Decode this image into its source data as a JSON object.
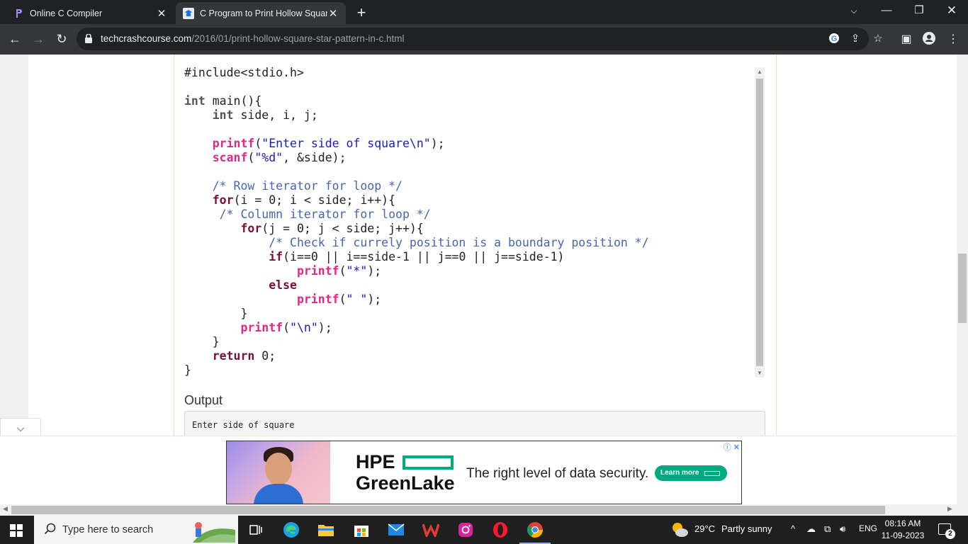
{
  "browser": {
    "tabs": [
      {
        "title": "Online C Compiler",
        "active": false
      },
      {
        "title": "C Program to Print Hollow Squar",
        "active": true
      }
    ],
    "url_host": "techcrashcourse.com",
    "url_path": "/2016/01/print-hollow-square-star-pattern-in-c.html"
  },
  "code_lines": [
    {
      "parts": [
        {
          "t": "#include<stdio.h>",
          "c": "pp"
        }
      ]
    },
    {
      "parts": []
    },
    {
      "parts": [
        {
          "t": "int",
          "c": "ty"
        },
        {
          "t": " main(){",
          "c": ""
        }
      ]
    },
    {
      "parts": [
        {
          "t": "    ",
          "c": ""
        },
        {
          "t": "int",
          "c": "ty"
        },
        {
          "t": " side, i, j;",
          "c": ""
        }
      ]
    },
    {
      "parts": []
    },
    {
      "parts": [
        {
          "t": "    ",
          "c": ""
        },
        {
          "t": "printf",
          "c": "fn"
        },
        {
          "t": "(",
          "c": ""
        },
        {
          "t": "\"Enter side of square\\n\"",
          "c": "str"
        },
        {
          "t": ");",
          "c": ""
        }
      ]
    },
    {
      "parts": [
        {
          "t": "    ",
          "c": ""
        },
        {
          "t": "scanf",
          "c": "fn"
        },
        {
          "t": "(",
          "c": ""
        },
        {
          "t": "\"%d\"",
          "c": "str"
        },
        {
          "t": ", &side);",
          "c": ""
        }
      ]
    },
    {
      "parts": []
    },
    {
      "parts": [
        {
          "t": "    ",
          "c": ""
        },
        {
          "t": "/* Row iterator for loop */",
          "c": "cm"
        }
      ]
    },
    {
      "parts": [
        {
          "t": "    ",
          "c": ""
        },
        {
          "t": "for",
          "c": "kw"
        },
        {
          "t": "(i = 0; i < side; i++){",
          "c": ""
        }
      ]
    },
    {
      "parts": [
        {
          "t": "     ",
          "c": ""
        },
        {
          "t": "/* Column iterator for loop */",
          "c": "cm"
        }
      ]
    },
    {
      "parts": [
        {
          "t": "        ",
          "c": ""
        },
        {
          "t": "for",
          "c": "kw"
        },
        {
          "t": "(j = 0; j < side; j++){",
          "c": ""
        }
      ]
    },
    {
      "parts": [
        {
          "t": "            ",
          "c": ""
        },
        {
          "t": "/* Check if currely position is a boundary position */",
          "c": "cm"
        }
      ]
    },
    {
      "parts": [
        {
          "t": "            ",
          "c": ""
        },
        {
          "t": "if",
          "c": "kw"
        },
        {
          "t": "(i==0 || i==side-1 || j==0 || j==side-1)",
          "c": ""
        }
      ]
    },
    {
      "parts": [
        {
          "t": "                ",
          "c": ""
        },
        {
          "t": "printf",
          "c": "fn"
        },
        {
          "t": "(",
          "c": ""
        },
        {
          "t": "\"*\"",
          "c": "str"
        },
        {
          "t": ");",
          "c": ""
        }
      ]
    },
    {
      "parts": [
        {
          "t": "            ",
          "c": ""
        },
        {
          "t": "else",
          "c": "kw"
        }
      ]
    },
    {
      "parts": [
        {
          "t": "                ",
          "c": ""
        },
        {
          "t": "printf",
          "c": "fn"
        },
        {
          "t": "(",
          "c": ""
        },
        {
          "t": "\" \"",
          "c": "str"
        },
        {
          "t": ");",
          "c": ""
        }
      ]
    },
    {
      "parts": [
        {
          "t": "        }",
          "c": ""
        }
      ]
    },
    {
      "parts": [
        {
          "t": "        ",
          "c": ""
        },
        {
          "t": "printf",
          "c": "fn"
        },
        {
          "t": "(",
          "c": ""
        },
        {
          "t": "\"\\n\"",
          "c": "str"
        },
        {
          "t": ");",
          "c": ""
        }
      ]
    },
    {
      "parts": [
        {
          "t": "    }",
          "c": ""
        }
      ]
    },
    {
      "parts": [
        {
          "t": "    ",
          "c": ""
        },
        {
          "t": "return",
          "c": "kw"
        },
        {
          "t": " 0;",
          "c": ""
        }
      ]
    },
    {
      "parts": [
        {
          "t": "}",
          "c": ""
        }
      ]
    }
  ],
  "output": {
    "heading": "Output",
    "text": "Enter side of square"
  },
  "ad": {
    "brand_line1": "HPE",
    "brand_line2": "GreenLake",
    "tagline": "The right level of data security.",
    "cta": "Learn more",
    "adchoices": "ⓘ ✕"
  },
  "taskbar": {
    "search_placeholder": "Type here to search",
    "weather_temp": "29°C",
    "weather_desc": "Partly sunny",
    "language": "ENG",
    "time": "08:16 AM",
    "date": "11-09-2023",
    "notification_count": "2"
  },
  "colors": {
    "keyword": "#7a0f3b",
    "function": "#e0278b",
    "string": "#1a1acd",
    "comment": "#4865b5",
    "hpe_green": "#01a982"
  }
}
